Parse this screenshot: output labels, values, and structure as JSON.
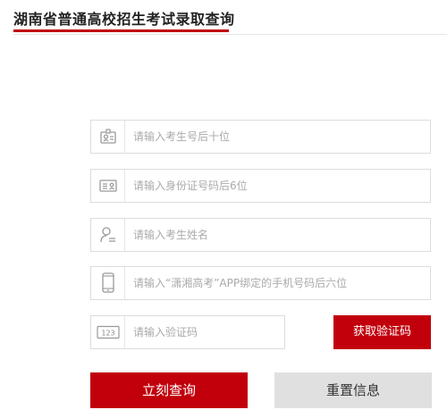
{
  "header": {
    "title": "湖南省普通高校招生考试录取查询"
  },
  "form": {
    "exam_number": {
      "icon": "id-card-icon",
      "placeholder": "请输入考生号后十位"
    },
    "id_number": {
      "icon": "identity-card-icon",
      "placeholder": "请输入身份证号码后6位"
    },
    "name": {
      "icon": "user-icon",
      "placeholder": "请输入考生姓名"
    },
    "phone": {
      "icon": "mobile-phone-icon",
      "placeholder": "请输入“潇湘高考”APP绑定的手机号码后六位"
    },
    "captcha": {
      "icon": "number-code-icon",
      "icon_text": "123",
      "placeholder": "请输入验证码"
    }
  },
  "buttons": {
    "get_code": "获取验证码",
    "submit": "立刻查询",
    "reset": "重置信息"
  },
  "colors": {
    "accent": "#c1000c",
    "reset_button_bg": "#e0e0e0",
    "placeholder": "#aaaaaa",
    "border": "#dcdcdc"
  }
}
